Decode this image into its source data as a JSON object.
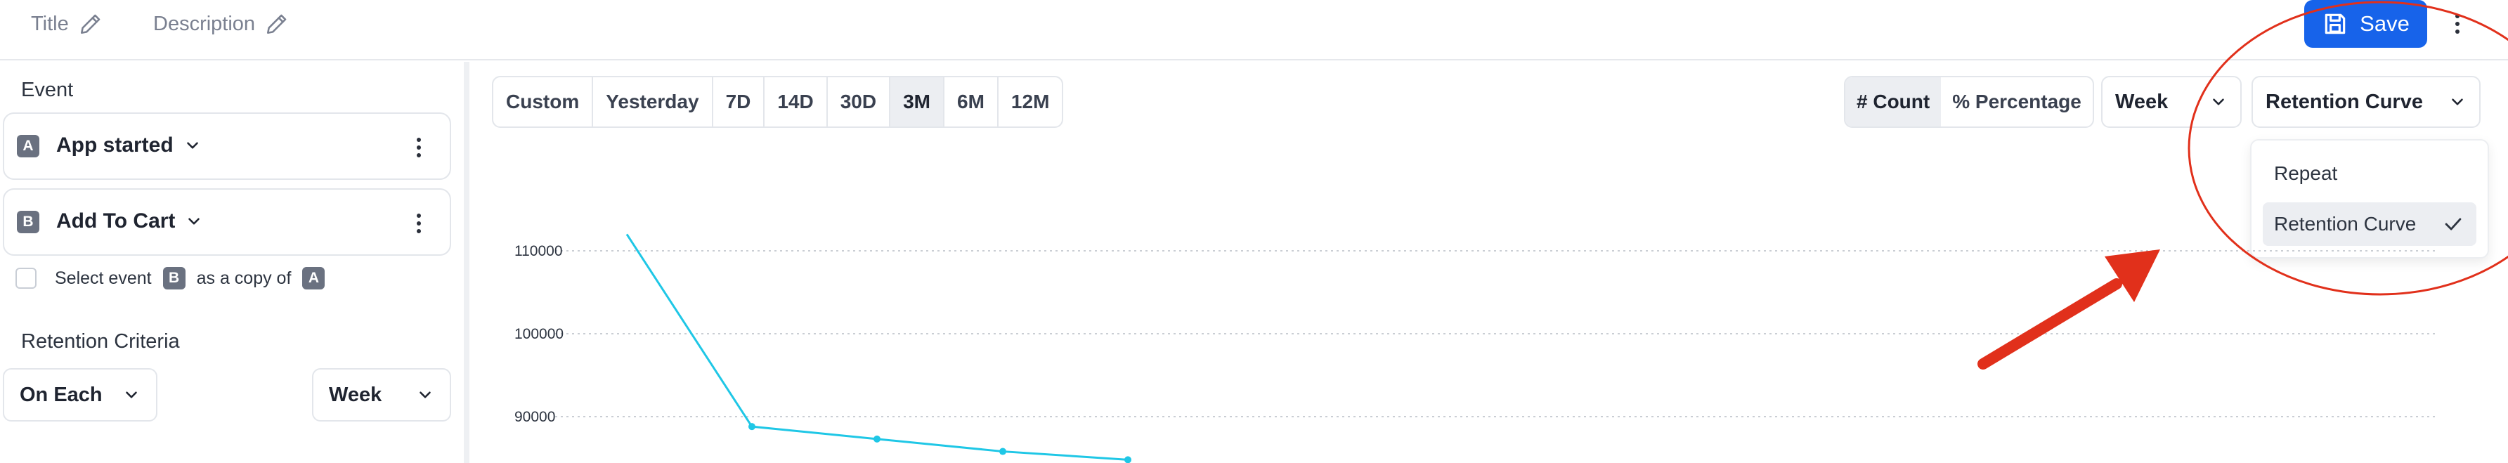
{
  "header": {
    "title_label": "Title",
    "description_label": "Description",
    "save_label": "Save"
  },
  "sidebar": {
    "event_heading": "Event",
    "events": [
      {
        "badge": "A",
        "name": "App started"
      },
      {
        "badge": "B",
        "name": "Add To Cart"
      }
    ],
    "copy_row": {
      "prefix": "Select event",
      "badge_1": "B",
      "middle": "as a copy of",
      "badge_2": "A"
    },
    "criteria_heading": "Retention Criteria",
    "criteria_select": "On Each",
    "period_select": "Week"
  },
  "toolbar": {
    "ranges": [
      "Custom",
      "Yesterday",
      "7D",
      "14D",
      "30D",
      "3M",
      "6M",
      "12M"
    ],
    "active_range": "3M",
    "modes": [
      "# Count",
      "% Percentage"
    ],
    "active_mode": "# Count",
    "period": "Week",
    "chart_type": "Retention Curve"
  },
  "dropdown": {
    "options": [
      "Repeat",
      "Retention Curve"
    ],
    "selected": "Retention Curve"
  },
  "colors": {
    "accent": "#1763ea",
    "series": "#1fc7e6",
    "annotation": "#e1301b"
  },
  "chart_data": {
    "type": "line",
    "y_ticks": [
      110000,
      100000,
      90000
    ],
    "series": [
      {
        "values": [
          112000,
          88800,
          87300,
          85800,
          84800
        ]
      }
    ],
    "grid": true
  }
}
